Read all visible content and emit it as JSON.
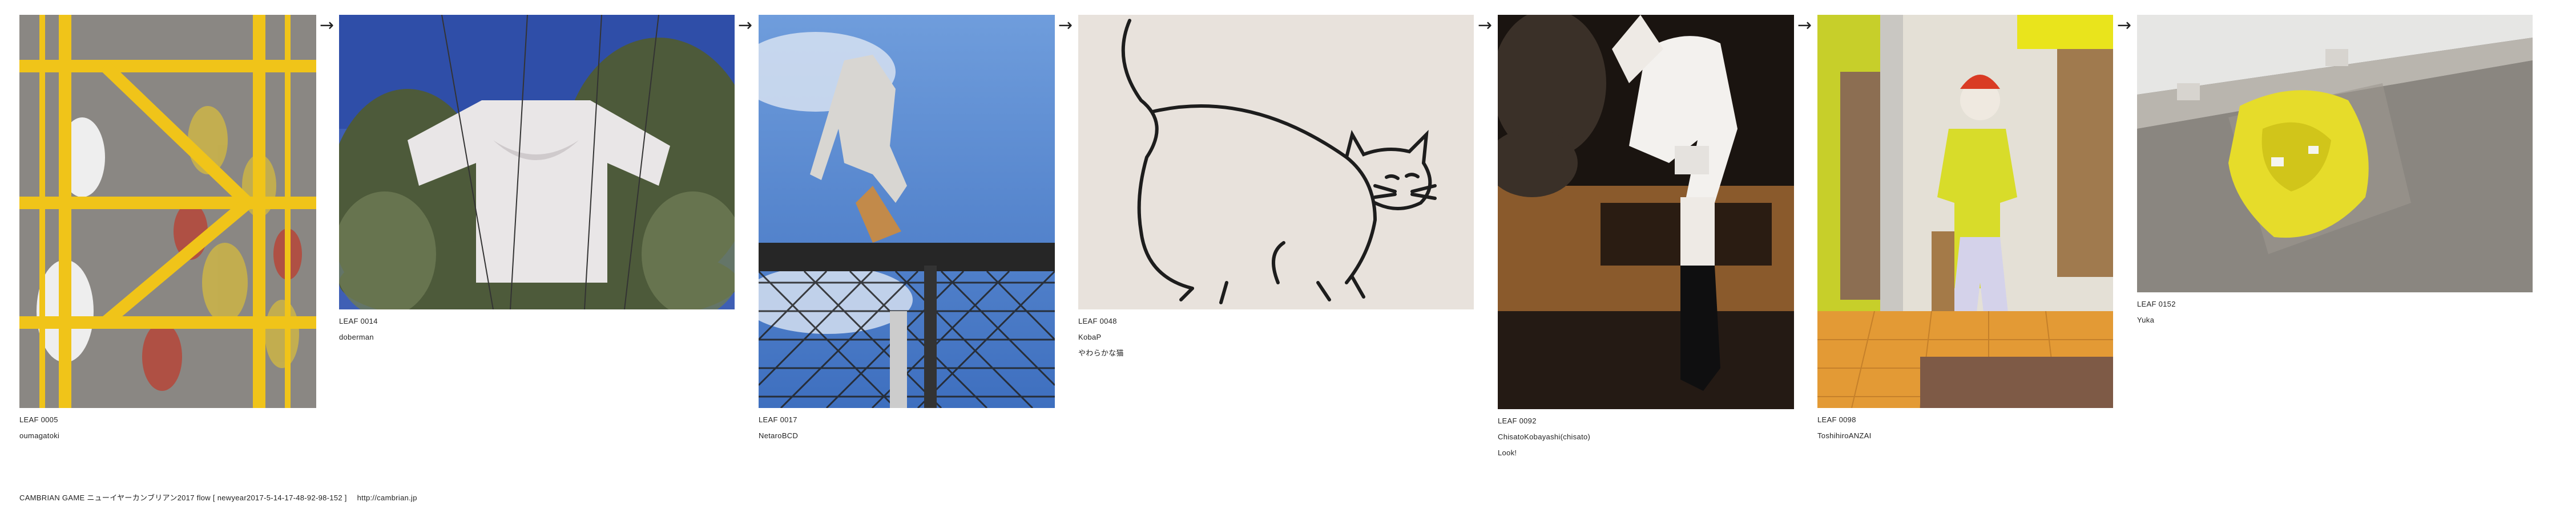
{
  "leaves": [
    {
      "id": "LEAF 0005",
      "author": "oumagatoki",
      "note": ""
    },
    {
      "id": "LEAF 0014",
      "author": "doberman",
      "note": ""
    },
    {
      "id": "LEAF 0017",
      "author": "NetaroBCD",
      "note": ""
    },
    {
      "id": "LEAF 0048",
      "author": "KobaP",
      "note": "やわらかな猫"
    },
    {
      "id": "LEAF 0092",
      "author": "ChisatoKobayashi(chisato)",
      "note": "Look!"
    },
    {
      "id": "LEAF 0098",
      "author": "ToshihiroANZAI",
      "note": ""
    },
    {
      "id": "LEAF 0152",
      "author": "Yuka",
      "note": ""
    }
  ],
  "arrow_glyph": "→",
  "footer": {
    "title": "CAMBRIAN GAME  ニューイヤーカンブリアン2017  flow [ newyear2017-5-14-17-48-92-98-152 ]",
    "url": "http://cambrian.jp"
  },
  "photo_subjects": [
    "yellow-stairs-image",
    "tshirt-on-wires-image",
    "cutout-man-on-fence-image",
    "cat-drawing-image",
    "mannequin-legs-image",
    "mannequin-shop-image",
    "yellow-bag-image"
  ]
}
